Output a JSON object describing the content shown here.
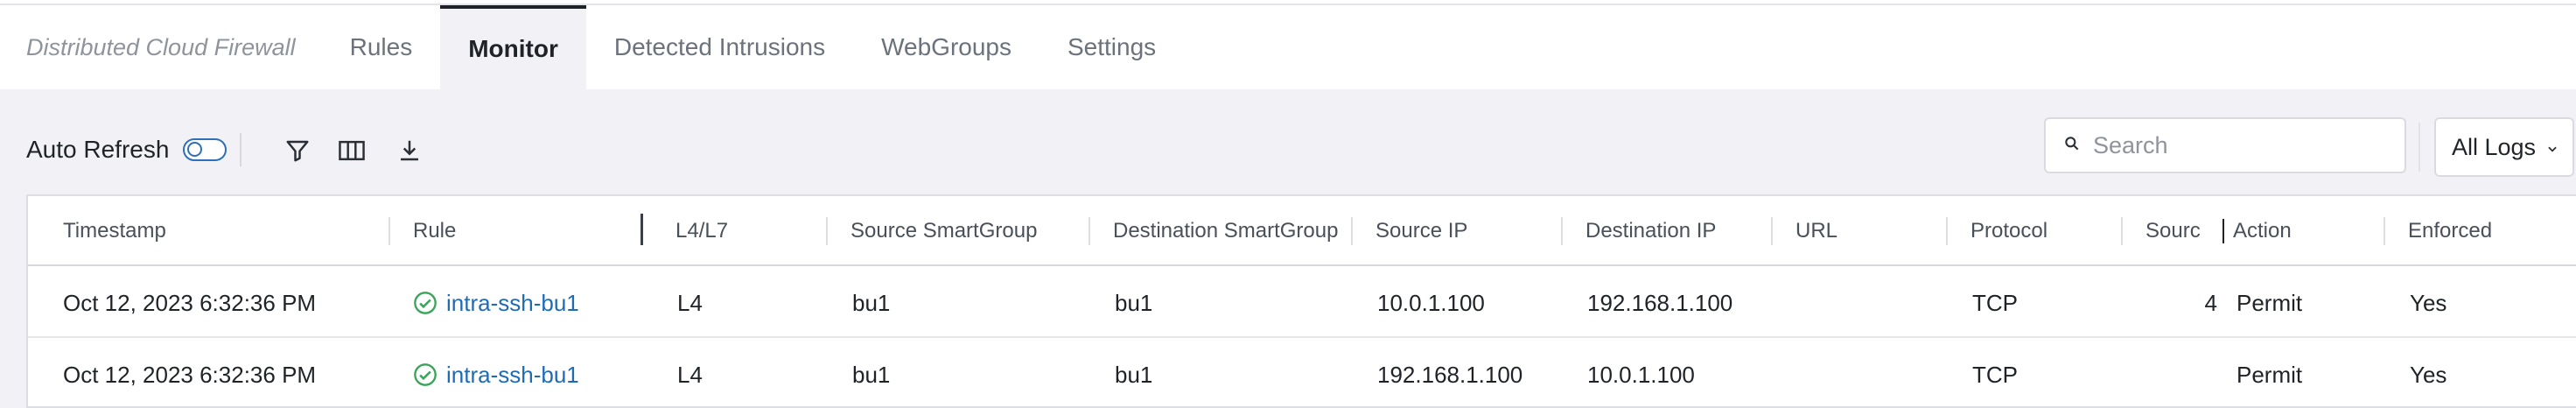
{
  "app": {
    "title": "Distributed Cloud Firewall"
  },
  "tabs": [
    {
      "label": "Rules",
      "active": false
    },
    {
      "label": "Monitor",
      "active": true
    },
    {
      "label": "Detected Intrusions",
      "active": false
    },
    {
      "label": "WebGroups",
      "active": false
    },
    {
      "label": "Settings",
      "active": false
    }
  ],
  "toolbar": {
    "auto_refresh_label": "Auto Refresh",
    "auto_refresh_on": false,
    "icons": [
      "filter-icon",
      "columns-icon",
      "download-icon"
    ]
  },
  "search": {
    "placeholder": "Search",
    "value": ""
  },
  "log_filter": {
    "selected": "All Logs"
  },
  "table": {
    "columns": [
      "Timestamp",
      "Rule",
      "L4/L7",
      "Source SmartGroup",
      "Destination SmartGroup",
      "Source IP",
      "Destination IP",
      "URL",
      "Protocol",
      "Sourc",
      "Action",
      "Enforced"
    ],
    "rows": [
      {
        "timestamp": "Oct 12, 2023 6:32:36 PM",
        "rule": "intra-ssh-bu1",
        "layer": "L4",
        "src_group": "bu1",
        "dst_group": "bu1",
        "src_ip": "10.0.1.100",
        "dst_ip": "192.168.1.100",
        "url": "",
        "protocol": "TCP",
        "src_port": "4",
        "action": "Permit",
        "enforced": "Yes"
      },
      {
        "timestamp": "Oct 12, 2023 6:32:36 PM",
        "rule": "intra-ssh-bu1",
        "layer": "L4",
        "src_group": "bu1",
        "dst_group": "bu1",
        "src_ip": "192.168.1.100",
        "dst_ip": "10.0.1.100",
        "url": "",
        "protocol": "TCP",
        "src_port": "",
        "action": "Permit",
        "enforced": "Yes"
      }
    ]
  },
  "colors": {
    "link": "#1f6bb5",
    "accent": "#2d6fb8",
    "success": "#3aa55a",
    "active_tab_border": "#1f2328"
  }
}
